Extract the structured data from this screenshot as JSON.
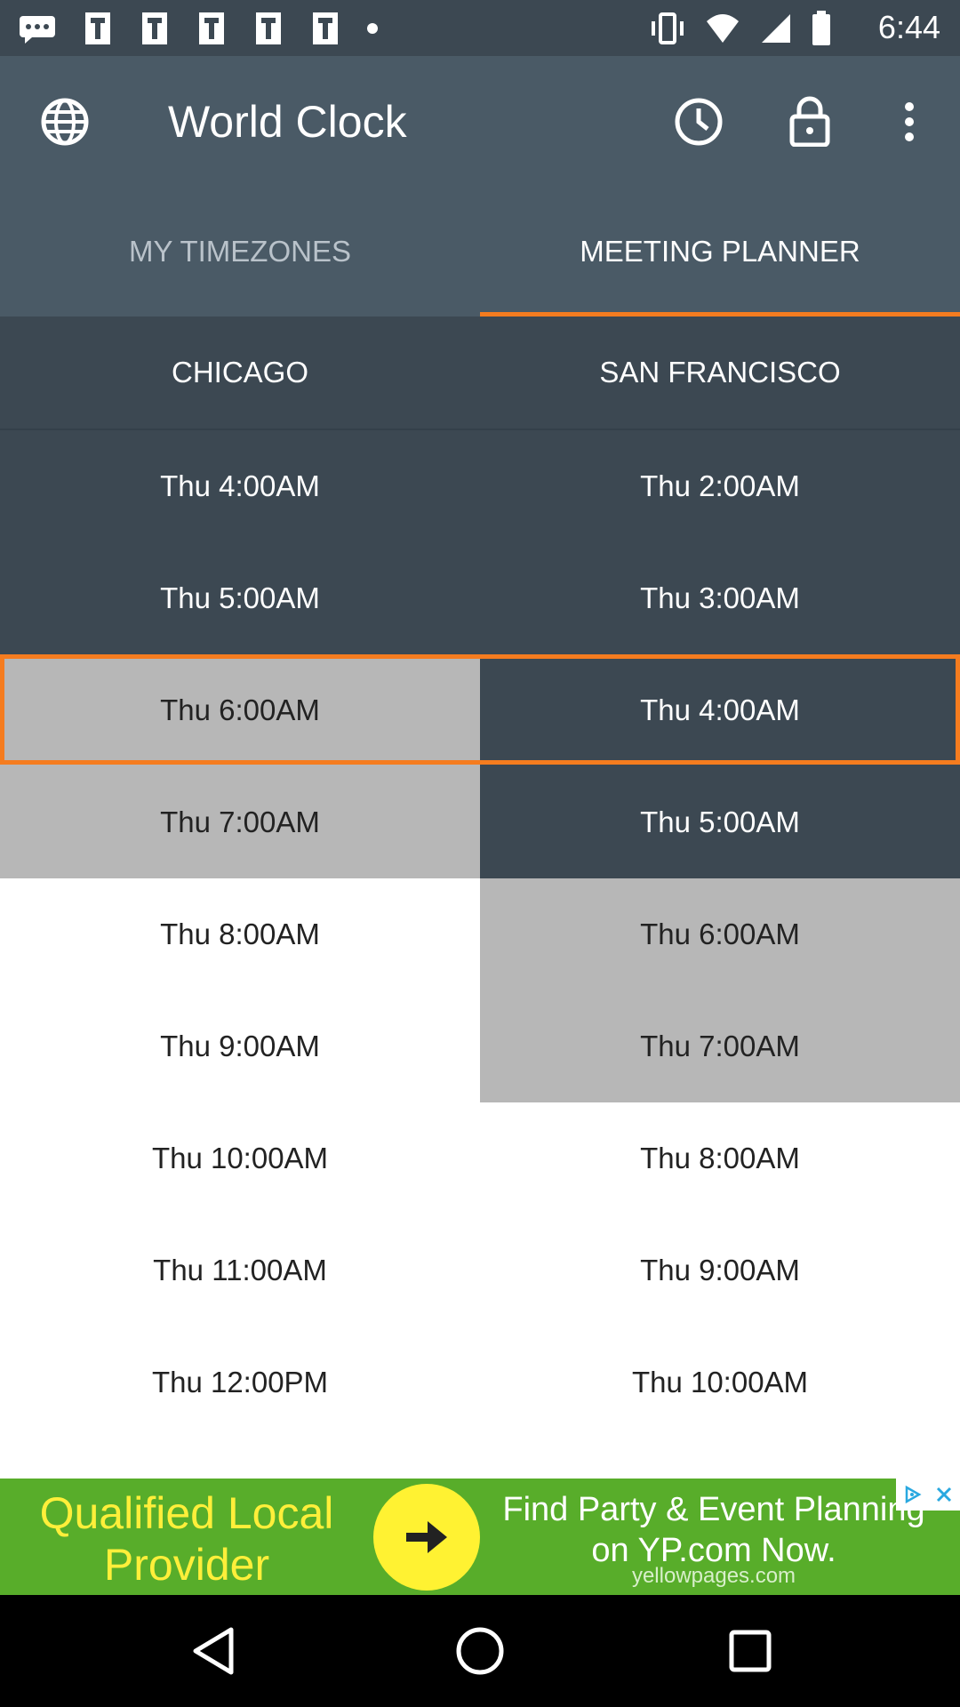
{
  "status_bar": {
    "time": "6:44"
  },
  "app_bar": {
    "title": "World Clock"
  },
  "tabs": [
    {
      "label": "MY TIMEZONES",
      "active": false
    },
    {
      "label": "MEETING PLANNER",
      "active": true
    }
  ],
  "columns": [
    "CHICAGO",
    "SAN FRANCISCO"
  ],
  "rows": [
    {
      "left": "Thu 4:00AM",
      "right": "Thu 2:00AM",
      "left_style": "dark",
      "right_style": "dark"
    },
    {
      "left": "Thu 5:00AM",
      "right": "Thu 3:00AM",
      "left_style": "dark",
      "right_style": "dark"
    },
    {
      "left": "Thu 6:00AM",
      "right": "Thu 4:00AM",
      "left_style": "gray",
      "right_style": "dark"
    },
    {
      "left": "Thu 7:00AM",
      "right": "Thu 5:00AM",
      "left_style": "gray",
      "right_style": "dark"
    },
    {
      "left": "Thu 8:00AM",
      "right": "Thu 6:00AM",
      "left_style": "white",
      "right_style": "gray"
    },
    {
      "left": "Thu 9:00AM",
      "right": "Thu 7:00AM",
      "left_style": "white",
      "right_style": "gray"
    },
    {
      "left": "Thu 10:00AM",
      "right": "Thu 8:00AM",
      "left_style": "white",
      "right_style": "white"
    },
    {
      "left": "Thu 11:00AM",
      "right": "Thu 9:00AM",
      "left_style": "white",
      "right_style": "white"
    },
    {
      "left": "Thu 12:00PM",
      "right": "Thu 10:00AM",
      "left_style": "white",
      "right_style": "white"
    }
  ],
  "ad": {
    "left_text": "Qualified Local Provider",
    "right_text": "Find Party & Event Planning on YP.com Now.",
    "domain": "yellowpages.com"
  },
  "colors": {
    "accent": "#f57c1f",
    "app_bar": "#4a5a66",
    "dark_cell": "#3c4852",
    "gray_cell": "#b7b7b7",
    "ad_background": "#58ad2a"
  }
}
